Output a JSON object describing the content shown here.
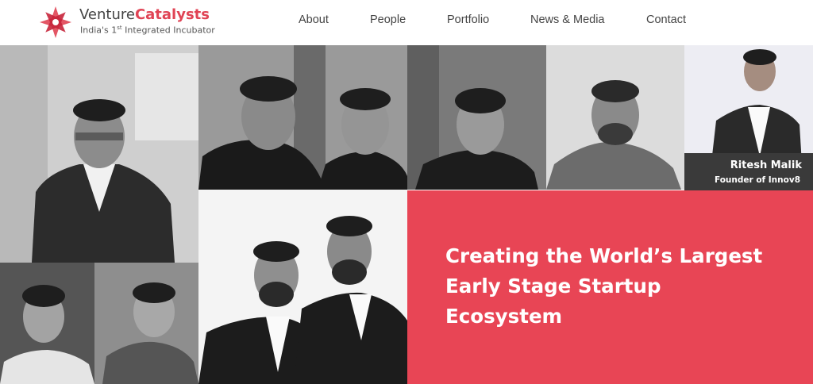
{
  "brand": {
    "name_part1": "Venture",
    "name_part2": "Catalysts",
    "tagline_pre": "India's 1",
    "tagline_sup": "st",
    "tagline_post": " Integrated Incubator",
    "logo_icon": "flower-logo-icon"
  },
  "nav": {
    "items": [
      {
        "label": "About"
      },
      {
        "label": "People"
      },
      {
        "label": "Portfolio"
      },
      {
        "label": "News & Media"
      },
      {
        "label": "Contact"
      }
    ]
  },
  "featured": {
    "name": "Ritesh Malik",
    "role": "Founder of Innov8"
  },
  "hero": {
    "lines": [
      "Creating the World’s Largest",
      "Early Stage Startup",
      "Ecosystem"
    ]
  },
  "colors": {
    "accent": "#e84555",
    "brand_red": "#e04455",
    "nav_text": "#444444",
    "caption_bg": "#3a3a3a"
  }
}
